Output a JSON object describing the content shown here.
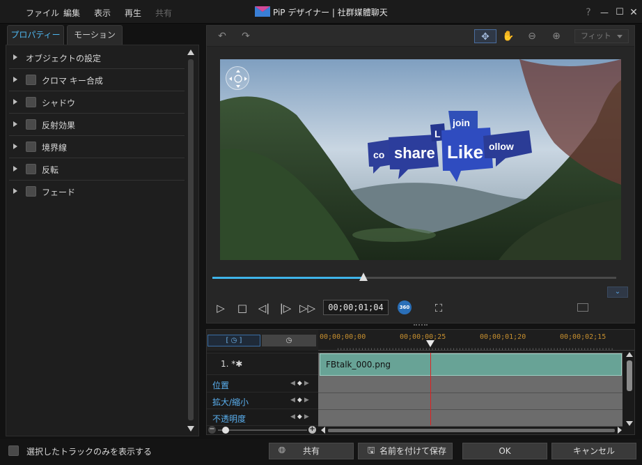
{
  "menu": [
    {
      "label": "ファイル",
      "enabled": true
    },
    {
      "label": "編集",
      "enabled": true
    },
    {
      "label": "表示",
      "enabled": true
    },
    {
      "label": "再生",
      "enabled": true
    },
    {
      "label": "共有",
      "enabled": false
    }
  ],
  "window": {
    "title": "PiP デザイナー  |  社群媒體聊天",
    "help": "?",
    "minimize": "—",
    "maximize": "☐",
    "close": "✕"
  },
  "tabs": {
    "properties": "プロパティー",
    "motion": "モーション",
    "active": "properties"
  },
  "properties": [
    {
      "label": "オブジェクトの設定",
      "checkbox": false
    },
    {
      "label": "クロマ キー合成",
      "checkbox": true,
      "checked": false
    },
    {
      "label": "シャドウ",
      "checkbox": true,
      "checked": false
    },
    {
      "label": "反射効果",
      "checkbox": true,
      "checked": false
    },
    {
      "label": "境界線",
      "checkbox": true,
      "checked": false
    },
    {
      "label": "反転",
      "checkbox": true,
      "checked": false
    },
    {
      "label": "フェード",
      "checkbox": true,
      "checked": false
    }
  ],
  "preview_toolbar": {
    "undo_icon": "undo-icon",
    "redo_icon": "redo-icon",
    "move_icon": "move-icon",
    "hand_icon": "hand-icon",
    "zoom_out_icon": "zoom-out-icon",
    "zoom_in_icon": "zoom-in-icon",
    "fit_label": "フィット"
  },
  "preview": {
    "bubbles": [
      "co",
      "share",
      "L",
      "join",
      "Like",
      "ollow"
    ]
  },
  "playback": {
    "timecode": "00;00;01;04",
    "progress": 0.36,
    "badge_360": "360"
  },
  "timeline": {
    "tab_a": "[ ◷ ]",
    "tab_b": "◷",
    "ruler": [
      "00;00;00;00",
      "00;00;00;25",
      "00;00;01;20",
      "00;00;02;15"
    ],
    "playhead_fraction": 0.355,
    "track_label": "1. *✱",
    "clip_name": "FBtalk_000.png",
    "keyframe_rows": [
      "位置",
      "拡大/縮小",
      "不透明度"
    ],
    "zoom_level": 0.05
  },
  "bottom": {
    "show_selected_label": "選択したトラックのみを表示する",
    "share_label": "共有",
    "save_as_label": "名前を付けて保存",
    "ok_label": "OK",
    "cancel_label": "キャンセル"
  },
  "colors": {
    "accent": "#4fb7f0",
    "timeline_ruler": "#c8902f",
    "clip": "#68a396",
    "playhead": "#e02020"
  }
}
